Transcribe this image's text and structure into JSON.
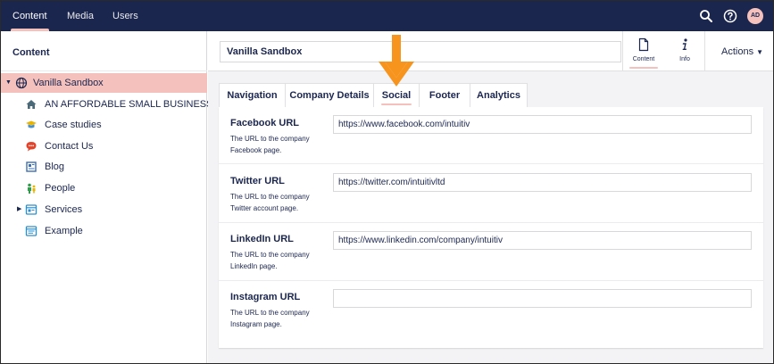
{
  "topbar": {
    "nav": [
      "Content",
      "Media",
      "Users"
    ],
    "active": "Content",
    "avatar_initials": "AD",
    "icons": [
      "search-icon",
      "help-icon"
    ]
  },
  "sidebar": {
    "title": "Content",
    "root": {
      "label": "Vanilla Sandbox",
      "icon": "globe-icon",
      "selected": true
    },
    "items": [
      {
        "label": "AN AFFORDABLE SMALL BUSINESS W...",
        "icon": "home-icon"
      },
      {
        "label": "Case studies",
        "icon": "graduation-cap-icon"
      },
      {
        "label": "Contact Us",
        "icon": "chat-bubble-icon"
      },
      {
        "label": "Blog",
        "icon": "blog-icon"
      },
      {
        "label": "People",
        "icon": "people-icon"
      },
      {
        "label": "Services",
        "icon": "services-icon",
        "has_children": true
      },
      {
        "label": "Example",
        "icon": "document-icon"
      }
    ]
  },
  "header": {
    "node_name": "Vanilla Sandbox",
    "apps": [
      {
        "label": "Content",
        "icon": "document-icon",
        "active": true
      },
      {
        "label": "Info",
        "icon": "info-icon",
        "active": false
      }
    ],
    "actions_label": "Actions"
  },
  "tabs": [
    {
      "label": "Navigation",
      "active": false
    },
    {
      "label": "Company Details",
      "active": false
    },
    {
      "label": "Social",
      "active": true
    },
    {
      "label": "Footer",
      "active": false
    },
    {
      "label": "Analytics",
      "active": false
    }
  ],
  "fields": [
    {
      "label": "Facebook URL",
      "description": "The URL to the company Facebook page.",
      "value": "https://www.facebook.com/intuitiv"
    },
    {
      "label": "Twitter URL",
      "description": "The URL to the company Twitter account page.",
      "value": "https://twitter.com/intuitivltd"
    },
    {
      "label": "LinkedIn URL",
      "description": "The URL to the company LinkedIn page.",
      "value": "https://www.linkedin.com/company/intuitiv"
    },
    {
      "label": "Instagram URL",
      "description": "The URL to the company Instagram page.",
      "value": ""
    }
  ],
  "colors": {
    "topbar": "#1b264f",
    "accent_pink": "#f5c1bc",
    "annotation_arrow": "#f7941d",
    "text": "#1b264f"
  }
}
